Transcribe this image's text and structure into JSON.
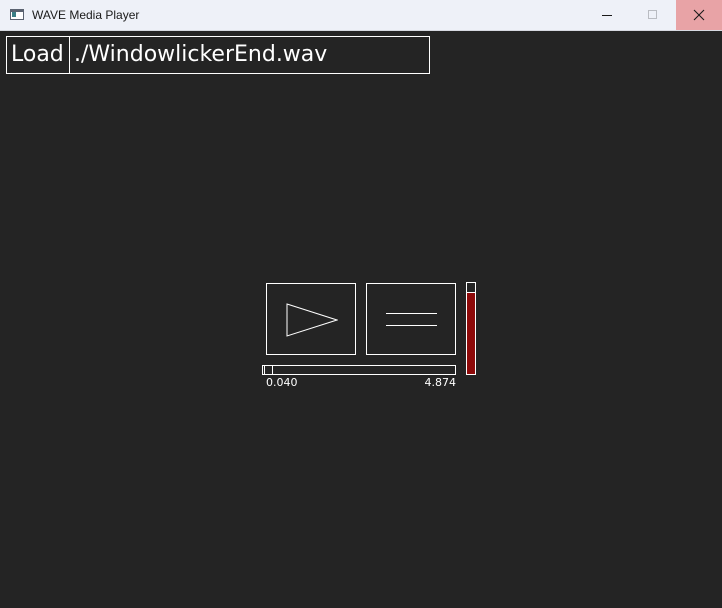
{
  "window": {
    "title": "WAVE Media Player",
    "icon": "app-window-icon"
  },
  "titlebar_buttons": {
    "minimize_icon": "minimize-icon",
    "maximize_icon": "maximize-icon",
    "close_icon": "close-icon"
  },
  "file": {
    "load_label": "Load",
    "path_value": "./WindowlickerEnd.wav"
  },
  "controls": {
    "play_icon": "play-icon",
    "menu_icon": "menu-icon"
  },
  "volume": {
    "level_fraction": 0.9,
    "fill_color": "#8e0a0a"
  },
  "playback": {
    "current_time": "0.040",
    "total_time": "4.874",
    "position_fraction": 0.008
  },
  "colors": {
    "background": "#242424",
    "foreground": "#ffffff",
    "titlebar": "#eef1f8",
    "close_hover": "#e8a3a6"
  }
}
